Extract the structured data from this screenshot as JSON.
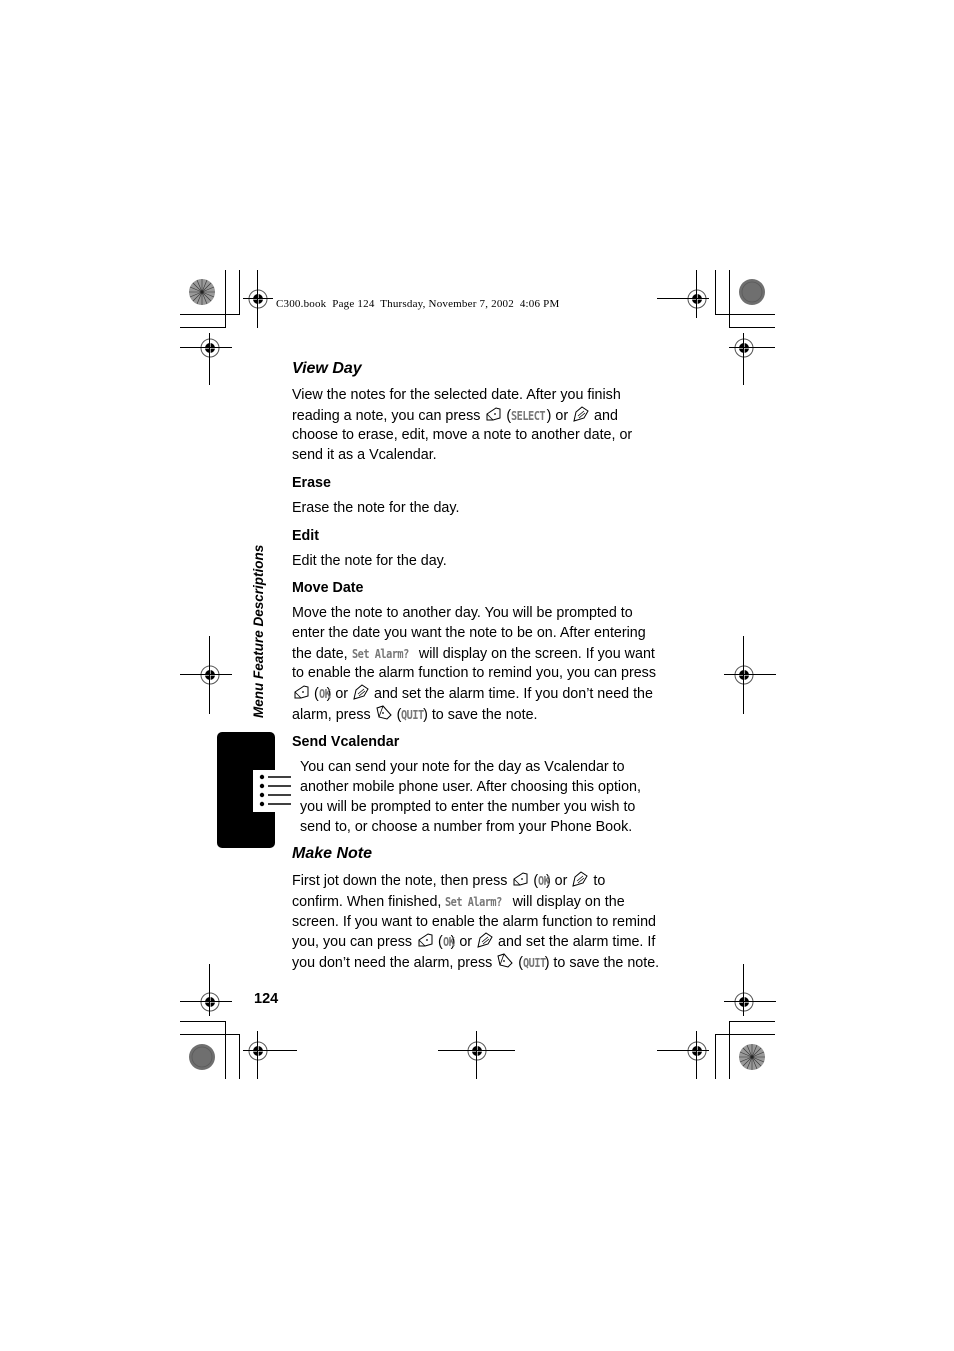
{
  "print_header": "C300.book  Page 124  Thursday, November 7, 2002  4:06 PM",
  "side_tab": {
    "label": "Menu Feature Descriptions",
    "icon": "menu-list-icon"
  },
  "page_number": "124",
  "sections": {
    "view_day": {
      "title": "View Day",
      "p1": "View the notes for the selected date. After you finish",
      "p2a": "reading a note, you can press ",
      "p2_key1": "SELECT",
      "p2b": " or ",
      "p2c": " and",
      "p3": "choose to erase, edit, move a note to another date, or",
      "p4": "send it as a Vcalendar."
    },
    "erase": {
      "title": "Erase",
      "body": "Erase the note for the day."
    },
    "edit": {
      "title": "Edit",
      "body": "Edit the note for the day."
    },
    "move_date": {
      "title": "Move Date",
      "l1": "Move the note to another day. You will be prompted to",
      "l2": "enter the date you want the note to be on. After entering",
      "l3a": "the date, ",
      "lcd_prompt": "Set Alarm?",
      "l3b": " will display on the screen. If you want",
      "l4": "to enable the alarm function to remind you, you can press",
      "l5_key": "OK",
      "l5b": " or ",
      "l5c": " and set the alarm time. If you don’t need the",
      "l6a": "alarm, press ",
      "l6_key": "QUIT",
      "l6b": " to save the note."
    },
    "send_vcalendar": {
      "title": "Send Vcalendar",
      "l1": "You can send your note for the day as Vcalendar to",
      "l2": "another mobile phone user. After choosing this option,",
      "l3": "you will be prompted to enter the number you wish to",
      "l4": "send to, or choose a number from your Phone Book."
    },
    "make_note": {
      "title": "Make Note",
      "l1a": "First jot down the note, then press ",
      "l1_key": "OK",
      "l1b": " or ",
      "l1c": " to",
      "l2a": "confirm. When finished, ",
      "lcd_prompt": "Set Alarm?",
      "l2b": " will display on the",
      "l3": "screen. If you want to enable the alarm function to remind",
      "l4a": "you, you can press ",
      "l4_key": "OK",
      "l4b": " or ",
      "l4c": " and set the alarm time. If",
      "l5a": "you don’t need the alarm, press ",
      "l5_key": "QUIT",
      "l5b": " to save the note."
    }
  },
  "icons": {
    "left_soft_key": "left-soft-key-icon",
    "menu_key": "menu-key-icon",
    "right_soft_key": "right-soft-key-icon"
  }
}
